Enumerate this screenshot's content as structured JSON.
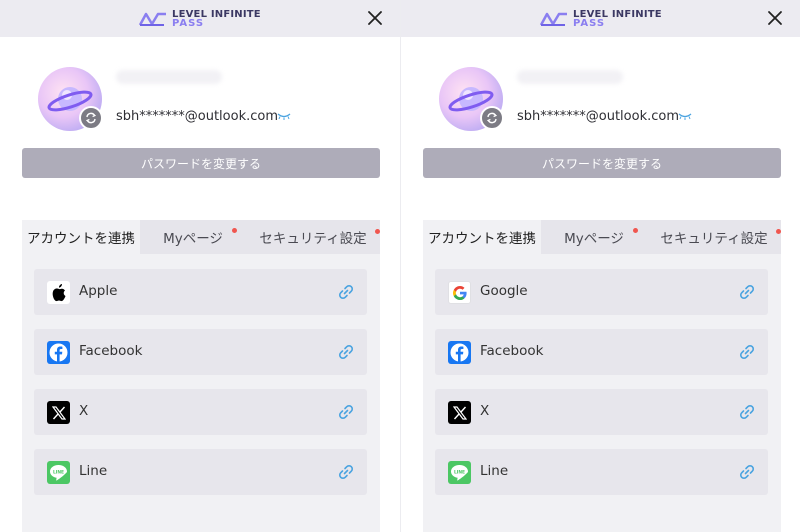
{
  "brand": {
    "line1": "LEVEL INFINITE",
    "line2": "PASS"
  },
  "user": {
    "email": "sbh*******@outlook.com"
  },
  "actions": {
    "change_password": "パスワードを変更する"
  },
  "tabs": [
    {
      "label": "アカウントを連携",
      "active": true,
      "notify": false
    },
    {
      "label": "Myページ",
      "active": false,
      "notify": true
    },
    {
      "label": "セキュリティ設定",
      "active": false,
      "notify": true
    }
  ],
  "panels": [
    {
      "accounts": [
        {
          "name": "Apple",
          "icon": "apple-icon"
        },
        {
          "name": "Facebook",
          "icon": "facebook-icon"
        },
        {
          "name": "X",
          "icon": "x-icon"
        },
        {
          "name": "Line",
          "icon": "line-icon"
        }
      ]
    },
    {
      "accounts": [
        {
          "name": "Google",
          "icon": "google-icon"
        },
        {
          "name": "Facebook",
          "icon": "facebook-icon"
        },
        {
          "name": "X",
          "icon": "x-icon"
        },
        {
          "name": "Line",
          "icon": "line-icon"
        }
      ]
    }
  ],
  "colors": {
    "accent": "#4aa3e0",
    "button": "#aeacb9",
    "notify": "#f0564f",
    "line": "#4cc764",
    "facebook": "#1877f2"
  }
}
